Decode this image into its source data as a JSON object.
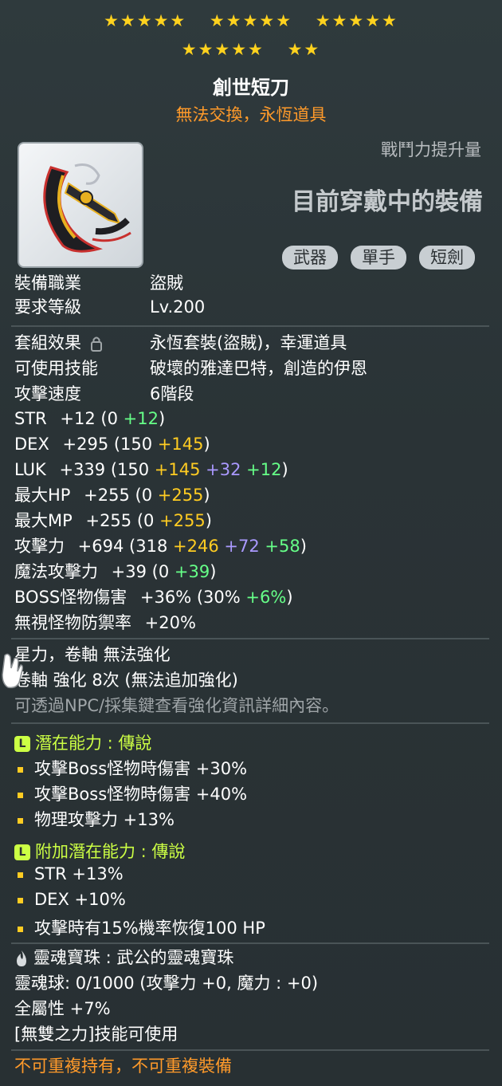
{
  "stars": {
    "row1": [
      "★★★★★",
      "★★★★★",
      "★★★★★"
    ],
    "row2": [
      "★★★★★",
      "★★"
    ]
  },
  "item": {
    "name": "創世短刀",
    "trade_note": "無法交換，永恆道具",
    "power_label": "戰鬥力提升量",
    "equipped_label": "目前穿戴中的裝備",
    "tags": [
      "武器",
      "單手",
      "短劍"
    ]
  },
  "requirements": {
    "job_label": "裝備職業",
    "job_value": "盜賊",
    "level_label": "要求等級",
    "level_value": "Lv.200"
  },
  "details": {
    "set_label": "套組效果",
    "set_value": "永恆套裝(盜賊)，幸運道具",
    "skill_label": "可使用技能",
    "skill_value": "破壞的雅達巴特，創造的伊恩",
    "speed_label": "攻擊速度",
    "speed_value": "6階段"
  },
  "stats": [
    {
      "name": "STR",
      "total": "+12",
      "open": " (0 ",
      "parts": [
        {
          "v": "+12",
          "c": "green"
        }
      ],
      "close": ")"
    },
    {
      "name": "DEX",
      "total": "+295",
      "open": " (150 ",
      "parts": [
        {
          "v": "+145",
          "c": "yellow"
        }
      ],
      "close": ")"
    },
    {
      "name": "LUK",
      "total": "+339",
      "open": " (150 ",
      "parts": [
        {
          "v": "+145",
          "c": "yellow"
        },
        {
          "v": "+32",
          "c": "purple"
        },
        {
          "v": "+12",
          "c": "green"
        }
      ],
      "close": ")"
    },
    {
      "name": "最大HP",
      "total": "+255",
      "open": " (0 ",
      "parts": [
        {
          "v": "+255",
          "c": "yellow"
        }
      ],
      "close": ")"
    },
    {
      "name": "最大MP",
      "total": "+255",
      "open": " (0 ",
      "parts": [
        {
          "v": "+255",
          "c": "yellow"
        }
      ],
      "close": ")"
    },
    {
      "name": "攻擊力",
      "total": "+694",
      "open": " (318 ",
      "parts": [
        {
          "v": "+246",
          "c": "yellow"
        },
        {
          "v": "+72",
          "c": "purple"
        },
        {
          "v": "+58",
          "c": "green"
        }
      ],
      "close": ")"
    },
    {
      "name": "魔法攻擊力",
      "total": "+39",
      "open": " (0 ",
      "parts": [
        {
          "v": "+39",
          "c": "green"
        }
      ],
      "close": ")"
    },
    {
      "name": "BOSS怪物傷害",
      "total": "+36%",
      "open": " (30% ",
      "parts": [
        {
          "v": "+6%",
          "c": "green"
        }
      ],
      "close": ")"
    },
    {
      "name": "無視怪物防禦率",
      "total": "+20%",
      "open": "",
      "parts": [],
      "close": ""
    }
  ],
  "enhance": {
    "line1": "星力，卷軸 無法強化",
    "line2": "卷軸 強化 8次 (無法追加強化)",
    "line3": "可透過NPC/採集鍵查看強化資訊詳細內容。"
  },
  "potential": {
    "title": "潛在能力 : 傳說",
    "lines": [
      "攻擊Boss怪物時傷害 +30%",
      "攻擊Boss怪物時傷害 +40%",
      "物理攻擊力 +13%"
    ]
  },
  "additional_potential": {
    "title": "附加潛在能力 : 傳說",
    "lines": [
      "STR +13%",
      "DEX +10%",
      "攻擊時有15%機率恢復100 HP"
    ]
  },
  "soul": {
    "title": "靈魂寶珠 : 武公的靈魂寶珠",
    "orb": "靈魂球: 0/1000 (攻擊力 +0, 魔力 : +0)",
    "allstat": "全屬性 +7%",
    "skill": "[無雙之力]技能可使用"
  },
  "footer": "不可重複持有，不可重複裝備",
  "colors": {
    "star": "#ffd21e",
    "orange": "#ff9a2a",
    "yellow": "#ffcc22",
    "green": "#66ff88",
    "purple": "#aa99ff",
    "lime": "#ccff44"
  },
  "icons": [
    "dagger-item-icon",
    "lock-icon",
    "legendary-l-icon",
    "soul-flame-icon",
    "glove-cursor-icon"
  ]
}
